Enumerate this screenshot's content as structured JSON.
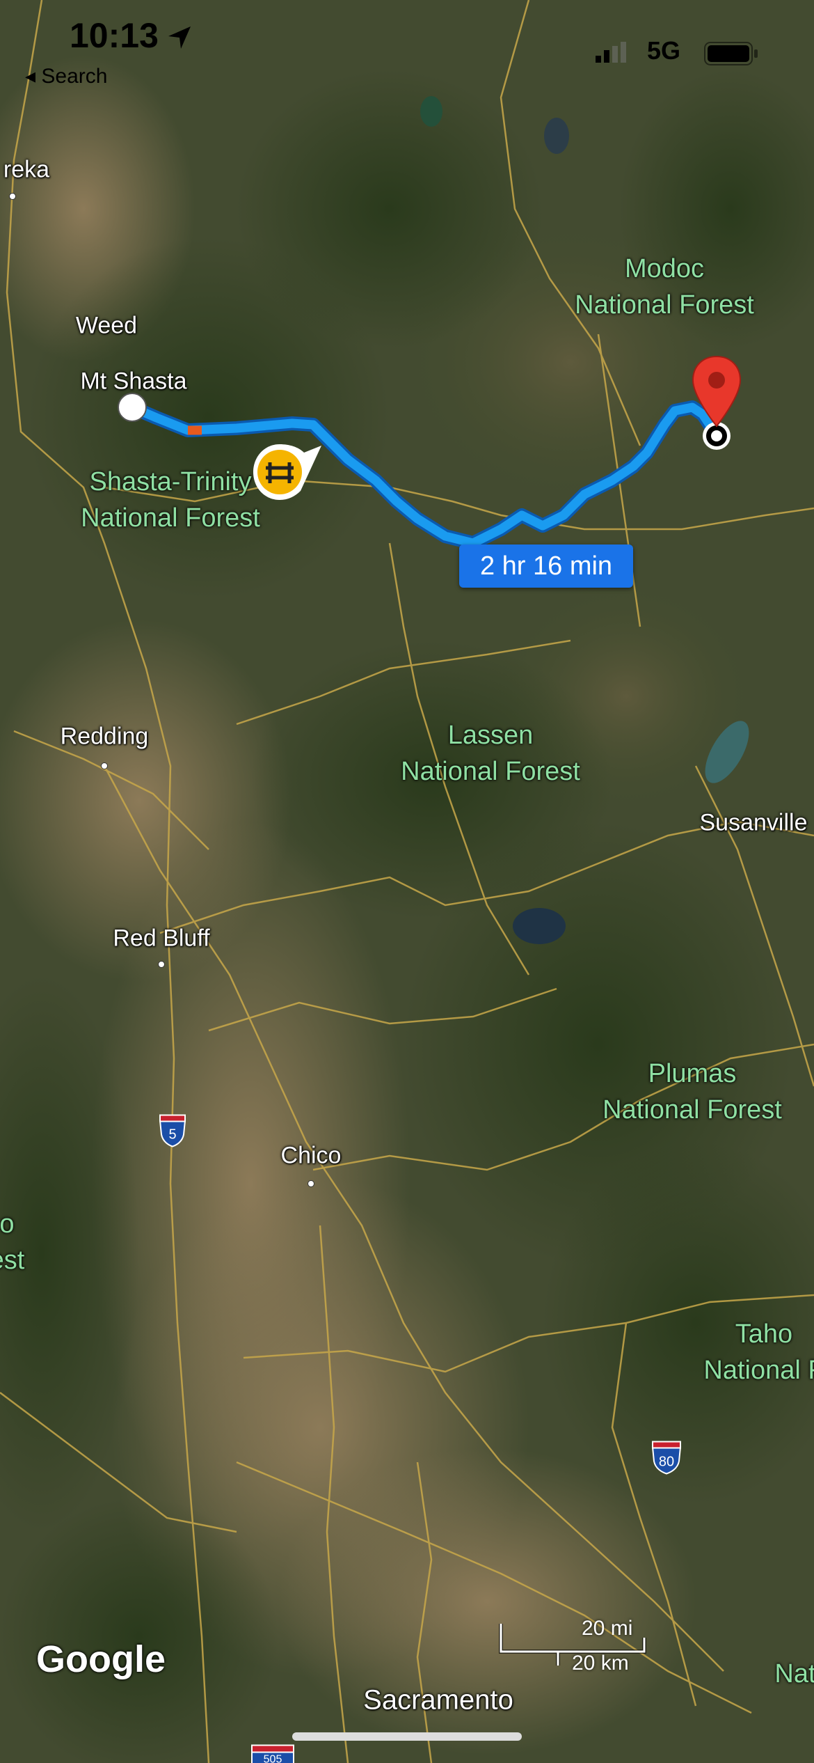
{
  "status_bar": {
    "time": "10:13",
    "back_label": "◂ Search",
    "network": "5G",
    "location_icon": "location-arrow-icon",
    "signal_icon": "signal-bars-icon",
    "battery_icon": "battery-icon"
  },
  "route": {
    "duration": "2 hr 16 min",
    "origin_icon": "origin-dot-icon",
    "destination_icon": "destination-pin-icon",
    "incident_icon": "road-work-icon",
    "route_color": "#1a9bf0"
  },
  "places": {
    "yreka": "reka",
    "weed": "Weed",
    "mt_shasta": "Mt Shasta",
    "redding": "Redding",
    "red_bluff": "Red Bluff",
    "chico": "Chico",
    "susanville": "Susanville",
    "sacramento": "Sacramento"
  },
  "forests": {
    "modoc": "Modoc\nNational Forest",
    "shasta_trinity": "Shasta-Trinity\nNational Forest",
    "lassen": "Lassen\nNational Forest",
    "plumas": "Plumas\nNational Forest",
    "tahoe": "Taho\nNational F",
    "mendocino": "o\nest",
    "nat": "Nat"
  },
  "highways": {
    "i5": "5",
    "i80": "80",
    "i505": "505"
  },
  "scale": {
    "miles": "20 mi",
    "km": "20 km"
  },
  "attribution": {
    "logo": "Google"
  }
}
